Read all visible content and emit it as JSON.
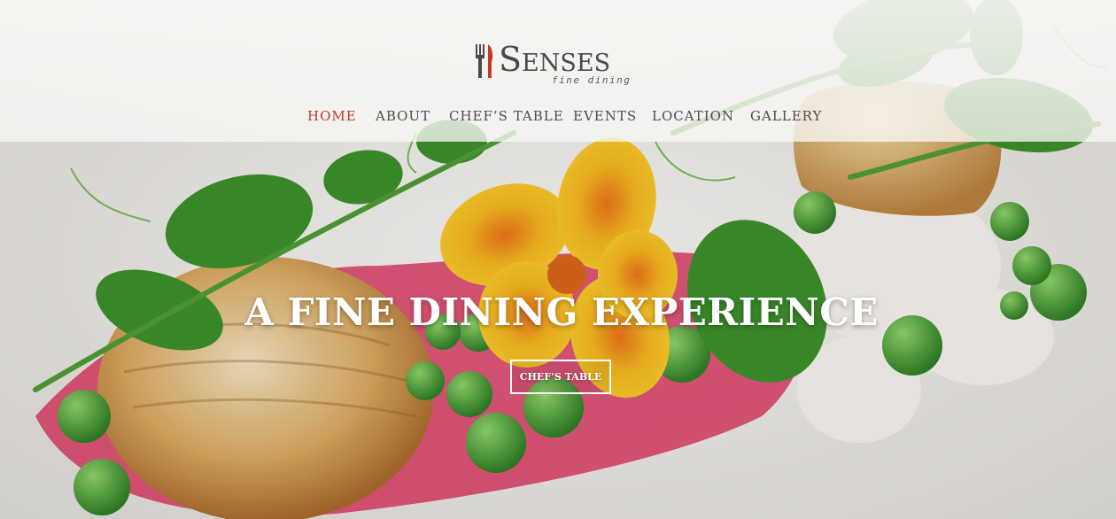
{
  "brand": {
    "name": "Senses",
    "tagline": "fine dining",
    "accent": "#c0392b",
    "icon": "fork-knife-icon"
  },
  "nav": {
    "items": [
      {
        "label": "Home",
        "active": true
      },
      {
        "label": "About",
        "active": false
      },
      {
        "label": "Chef’s Table",
        "active": false
      },
      {
        "label": "Events",
        "active": false
      },
      {
        "label": "Location",
        "active": false
      },
      {
        "label": "Gallery",
        "active": false
      }
    ]
  },
  "hero": {
    "headline": "A FINE DINING EXPERIENCE",
    "cta_label": "CHEF’S TABLE"
  }
}
